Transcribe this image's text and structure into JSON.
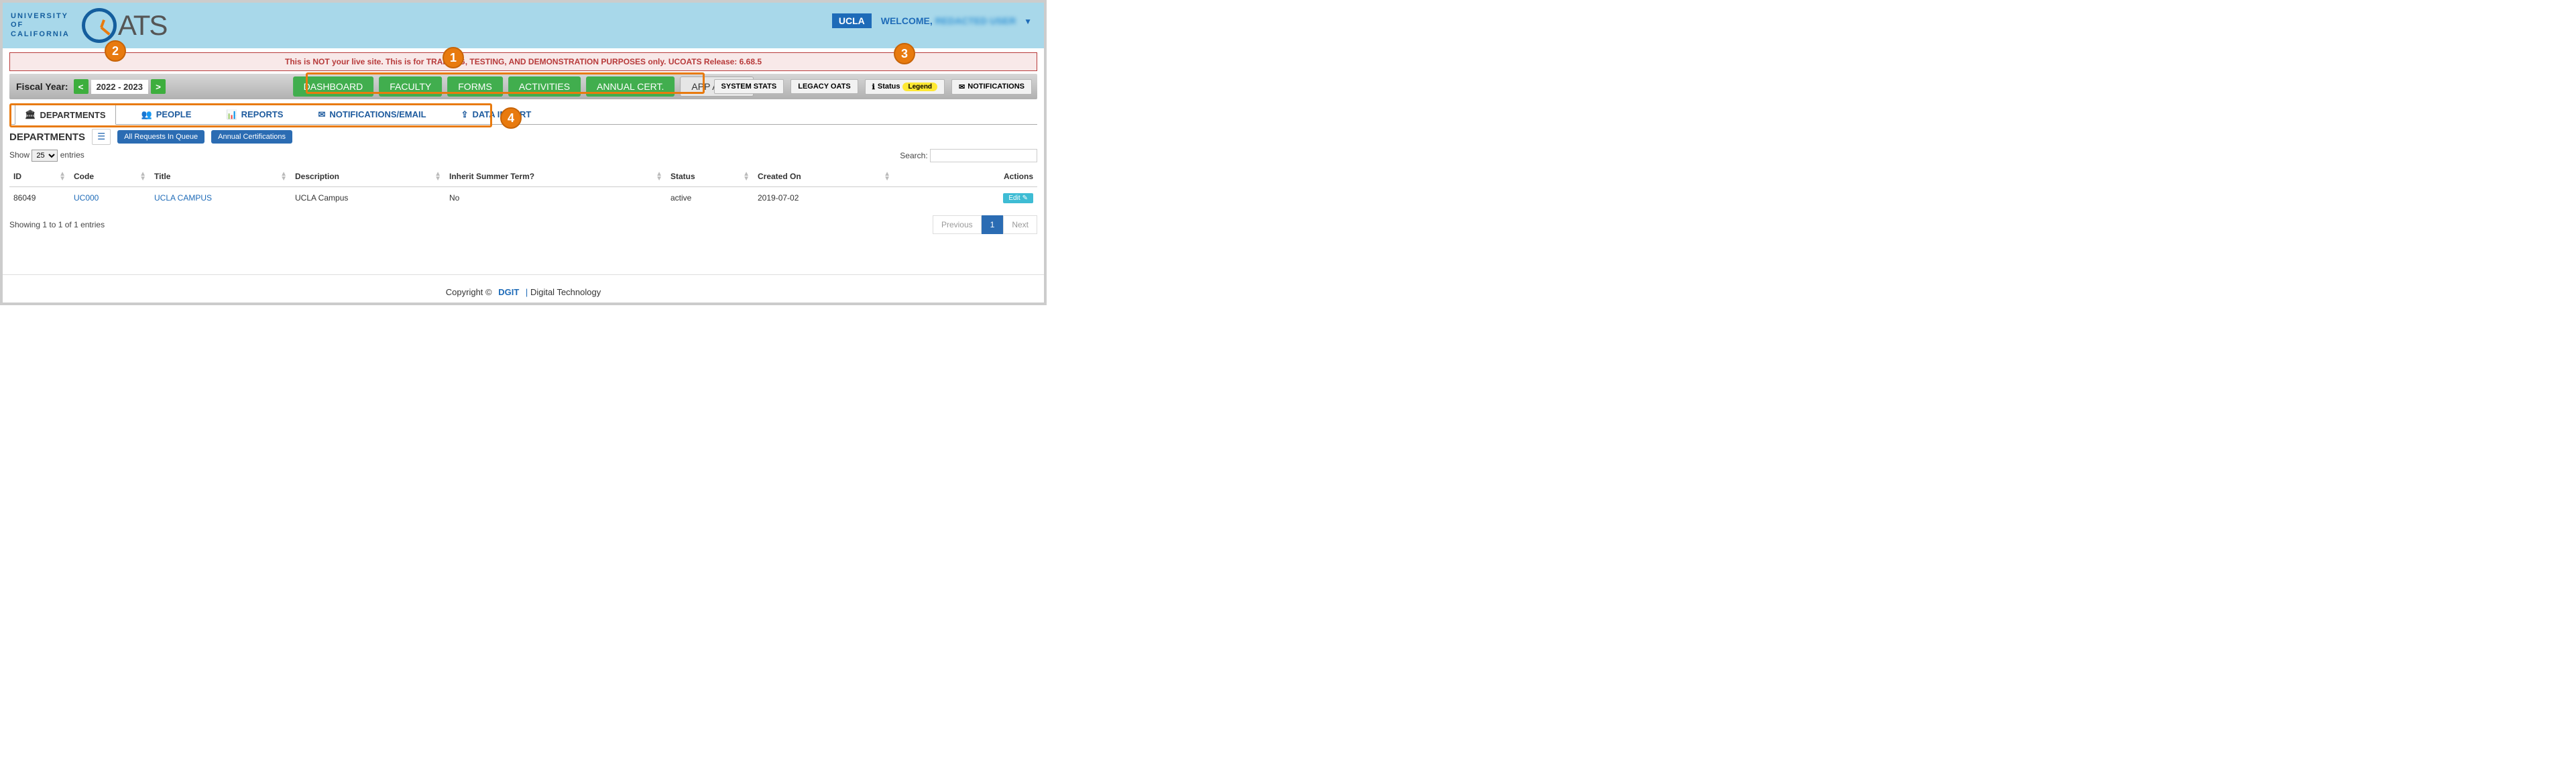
{
  "header": {
    "uc_line1": "UNIVERSITY",
    "uc_line2": "OF",
    "uc_line3": "CALIFORNIA",
    "oats_text": "ATS",
    "ucla_badge": "UCLA",
    "welcome": "WELCOME,",
    "welcome_name": "REDACTED USER"
  },
  "warning": "This is NOT your live site. This is for TRAINING, TESTING, AND DEMONSTRATION PURPOSES only. UCOATS Release: 6.68.5",
  "toolbar": {
    "fy_label": "Fiscal Year:",
    "fy_prev": "<",
    "fy_value": "2022 - 2023",
    "fy_next": ">",
    "main_nav": [
      "DASHBOARD",
      "FACULTY",
      "FORMS",
      "ACTIVITIES",
      "ANNUAL CERT.",
      "APP ADMIN"
    ],
    "tool_system_stats": "SYSTEM STATS",
    "tool_legacy": "LEGACY OATS",
    "tool_status": "Status",
    "tool_legend": "Legend",
    "tool_notifications": "NOTIFICATIONS"
  },
  "subnav": {
    "tabs": [
      {
        "label": "DEPARTMENTS",
        "icon": "building-icon"
      },
      {
        "label": "PEOPLE",
        "icon": "people-icon"
      },
      {
        "label": "REPORTS",
        "icon": "chart-icon"
      },
      {
        "label": "NOTIFICATIONS/EMAIL",
        "icon": "mail-icon"
      },
      {
        "label": "DATA IMPORT",
        "icon": "import-icon"
      }
    ]
  },
  "panel": {
    "title": "DEPARTMENTS",
    "btn_queue": "All Requests In Queue",
    "btn_annual": "Annual Certifications"
  },
  "table": {
    "show_prefix": "Show",
    "show_value": "25",
    "show_suffix": "entries",
    "search_label": "Search:",
    "search_value": "",
    "columns": [
      "ID",
      "Code",
      "Title",
      "Description",
      "Inherit Summer Term?",
      "Status",
      "Created On",
      "Actions"
    ],
    "rows": [
      {
        "id": "86049",
        "code": "UC000",
        "title": "UCLA CAMPUS",
        "description": "UCLA Campus",
        "inherit": "No",
        "status": "active",
        "created": "2019-07-02",
        "action": "Edit"
      }
    ],
    "info": "Showing 1 to 1 of 1 entries",
    "prev": "Previous",
    "page": "1",
    "next": "Next"
  },
  "footer": {
    "copyright": "Copyright ©",
    "dgit": "DGIT",
    "digital_tech": "Digital Technology"
  },
  "callouts": {
    "c1": "1",
    "c2": "2",
    "c3": "3",
    "c4": "4"
  }
}
